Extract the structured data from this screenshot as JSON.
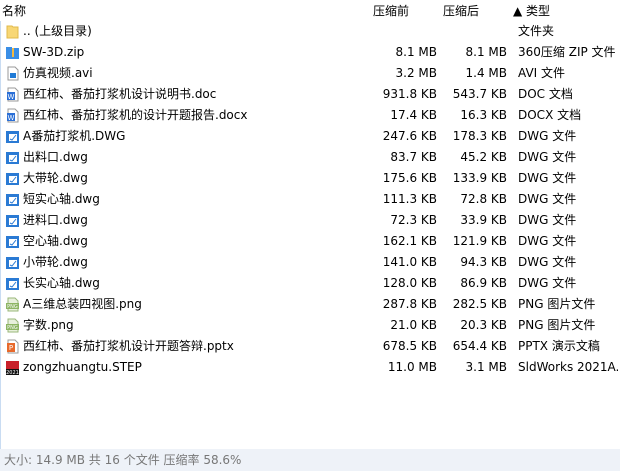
{
  "columns": {
    "name": "名称",
    "orig": "压缩前",
    "comp": "压缩后",
    "type": "▲ 类型"
  },
  "files": [
    {
      "name": ".. (上级目录)",
      "orig": "",
      "comp": "",
      "type": "文件夹",
      "icon": "folder"
    },
    {
      "name": "SW-3D.zip",
      "orig": "8.1 MB",
      "comp": "8.1 MB",
      "type": "360压缩 ZIP 文件",
      "icon": "zip"
    },
    {
      "name": "仿真视频.avi",
      "orig": "3.2 MB",
      "comp": "1.4 MB",
      "type": "AVI 文件",
      "icon": "video"
    },
    {
      "name": "西红柿、番茄打浆机设计说明书.doc",
      "orig": "931.8 KB",
      "comp": "543.7 KB",
      "type": "DOC 文档",
      "icon": "word"
    },
    {
      "name": "西红柿、番茄打浆机的设计开题报告.docx",
      "orig": "17.4 KB",
      "comp": "16.3 KB",
      "type": "DOCX 文档",
      "icon": "word"
    },
    {
      "name": "A番茄打浆机.DWG",
      "orig": "247.6 KB",
      "comp": "178.3 KB",
      "type": "DWG 文件",
      "icon": "dwg"
    },
    {
      "name": "出料口.dwg",
      "orig": "83.7 KB",
      "comp": "45.2 KB",
      "type": "DWG 文件",
      "icon": "dwg"
    },
    {
      "name": "大带轮.dwg",
      "orig": "175.6 KB",
      "comp": "133.9 KB",
      "type": "DWG 文件",
      "icon": "dwg"
    },
    {
      "name": "短实心轴.dwg",
      "orig": "111.3 KB",
      "comp": "72.8 KB",
      "type": "DWG 文件",
      "icon": "dwg"
    },
    {
      "name": "进料口.dwg",
      "orig": "72.3 KB",
      "comp": "33.9 KB",
      "type": "DWG 文件",
      "icon": "dwg"
    },
    {
      "name": "空心轴.dwg",
      "orig": "162.1 KB",
      "comp": "121.9 KB",
      "type": "DWG 文件",
      "icon": "dwg"
    },
    {
      "name": "小带轮.dwg",
      "orig": "141.0 KB",
      "comp": "94.3 KB",
      "type": "DWG 文件",
      "icon": "dwg"
    },
    {
      "name": "长实心轴.dwg",
      "orig": "128.0 KB",
      "comp": "86.9 KB",
      "type": "DWG 文件",
      "icon": "dwg"
    },
    {
      "name": "A三维总装四视图.png",
      "orig": "287.8 KB",
      "comp": "282.5 KB",
      "type": "PNG 图片文件",
      "icon": "png"
    },
    {
      "name": "字数.png",
      "orig": "21.0 KB",
      "comp": "20.3 KB",
      "type": "PNG 图片文件",
      "icon": "png"
    },
    {
      "name": "西红柿、番茄打浆机设计开题答辩.pptx",
      "orig": "678.5 KB",
      "comp": "654.4 KB",
      "type": "PPTX 演示文稿",
      "icon": "ppt"
    },
    {
      "name": "zongzhuangtu.STEP",
      "orig": "11.0 MB",
      "comp": "3.1 MB",
      "type": "SldWorks 2021A...",
      "icon": "step"
    }
  ],
  "status": "大小: 14.9 MB 共 16 个文件 压缩率 58.6%"
}
